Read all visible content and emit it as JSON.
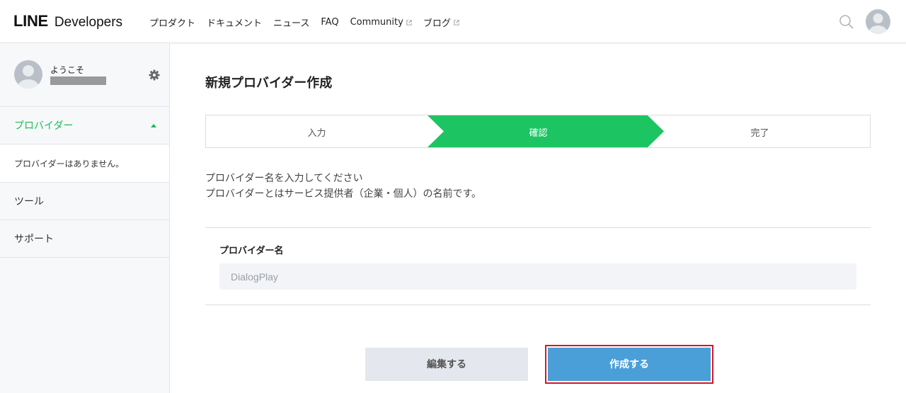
{
  "header": {
    "logo_main": "LINE",
    "logo_sub": "Developers",
    "nav": [
      {
        "label": "プロダクト",
        "external": false
      },
      {
        "label": "ドキュメント",
        "external": false
      },
      {
        "label": "ニュース",
        "external": false
      },
      {
        "label": "FAQ",
        "external": false
      },
      {
        "label": "Community",
        "external": true
      },
      {
        "label": "ブログ",
        "external": true
      }
    ],
    "icons": {
      "search": "search-icon",
      "avatar": "avatar-icon",
      "external": "external-link-icon"
    }
  },
  "sidebar": {
    "welcome": "ようこそ",
    "settings_icon": "gear-icon",
    "provider_header": "プロバイダー",
    "provider_empty": "プロバイダーはありません。",
    "items": [
      "ツール",
      "サポート"
    ],
    "accent_color": "#1dbd56"
  },
  "main": {
    "title": "新規プロバイダー作成",
    "steps": [
      "入力",
      "確認",
      "完了"
    ],
    "active_step": 1,
    "description": [
      "プロバイダー名を入力してください",
      "プロバイダーとはサービス提供者（企業・個人）の名前です。"
    ],
    "field_label": "プロバイダー名",
    "field_value": "DialogPlay",
    "buttons": {
      "edit": "編集する",
      "create": "作成する"
    }
  }
}
